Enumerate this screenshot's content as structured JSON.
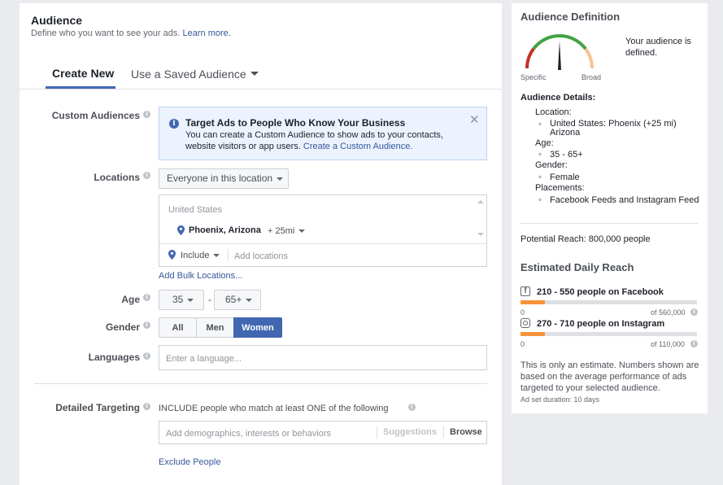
{
  "audience": {
    "title": "Audience",
    "subtitle": "Define who you want to see your ads.",
    "learn_more": "Learn more."
  },
  "tabs": {
    "create_new": "Create New",
    "saved": "Use a Saved Audience"
  },
  "custom_audiences": {
    "label": "Custom Audiences",
    "notice_title": "Target Ads to People Who Know Your Business",
    "notice_line1": "You can create a Custom Audience to show ads to your contacts,",
    "notice_line2": "website visitors or app users.",
    "notice_link": "Create a Custom Audience."
  },
  "locations": {
    "label": "Locations",
    "dropdown": "Everyone in this location",
    "country": "United States",
    "city": "Phoenix, Arizona",
    "radius": "+ 25mi",
    "include": "Include",
    "add_placeholder": "Add locations",
    "bulk": "Add Bulk Locations..."
  },
  "age": {
    "label": "Age",
    "min": "35",
    "dash": "-",
    "max": "65+"
  },
  "gender": {
    "label": "Gender",
    "options": [
      "All",
      "Men",
      "Women"
    ],
    "selected": "Women"
  },
  "languages": {
    "label": "Languages",
    "placeholder": "Enter a language..."
  },
  "detailed": {
    "label": "Detailed Targeting",
    "include_text": "INCLUDE people who match at least ONE of the following",
    "placeholder": "Add demographics, interests or behaviors",
    "suggestions": "Suggestions",
    "browse": "Browse",
    "exclude": "Exclude People"
  },
  "definition": {
    "title": "Audience Definition",
    "status": "Your audience is defined.",
    "specific": "Specific",
    "broad": "Broad",
    "gauge_level": 0.5,
    "details_title": "Audience Details:",
    "location_label": "Location:",
    "location_value_1": "United States: Phoenix (+25 mi)",
    "location_value_2": "Arizona",
    "age_label": "Age:",
    "age_value": "35 - 65+",
    "gender_label": "Gender:",
    "gender_value": "Female",
    "placements_label": "Placements:",
    "placements_value": "Facebook Feeds and Instagram Feed",
    "potential_reach": "Potential Reach: 800,000 people"
  },
  "daily_reach": {
    "title": "Estimated Daily Reach",
    "facebook": {
      "text": "210 - 550 people on Facebook",
      "min": "0",
      "max": "of 560,000",
      "fill": 0.14
    },
    "instagram": {
      "text": "270 - 710 people on Instagram",
      "min": "0",
      "max": "of 110,000",
      "fill": 0.14
    },
    "note": "This is only an estimate. Numbers shown are based on the average performance of ads targeted to your selected audience.",
    "duration": "Ad set duration: 10 days"
  },
  "colors": {
    "accent": "#4267b2",
    "link": "#365899",
    "gauge_red": "#c2342a",
    "gauge_green": "#42a242",
    "gauge_orange": "#f7923b"
  }
}
